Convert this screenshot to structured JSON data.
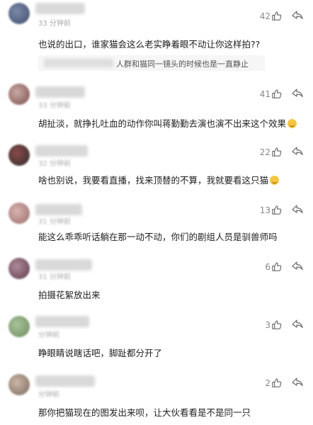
{
  "comments": [
    {
      "time": "33 分钟前",
      "likes": "42",
      "text": "也说的出口，谁家猫会这么老实睁着眼不动让你这样拍??",
      "reply": "人群和猫同一镜头的时候也是一直静止",
      "avatar_colors": [
        "#7b8aa8",
        "#3f4c6b"
      ]
    },
    {
      "time": "33 分钟前",
      "likes": "41",
      "text": "胡扯淡，就挣扎吐血的动作你叫蒋勤勤去演也演不出来这个效果",
      "emoji": "dizzy-face",
      "avatar_colors": [
        "#c9a9a6",
        "#7a4e4a"
      ]
    },
    {
      "time": "32 分钟前",
      "likes": "22",
      "text": "啥也别说，我要看直播，找来顶替的不算，我就要看这只猫",
      "emoji": "grin-face",
      "avatar_colors": [
        "#8a4a4a",
        "#2f2b2b"
      ]
    },
    {
      "time": "31 分钟前",
      "likes": "13",
      "text": "能这么乖乖听话躺在那一动不动，你们的剧组人员是驯兽师吗",
      "avatar_colors": [
        "#d8b3b0",
        "#9a6c69"
      ]
    },
    {
      "time": "31 分钟前",
      "likes": "6",
      "text": "拍摄花絮放出来",
      "avatar_colors": [
        "#5a3a4a",
        "#b08a9a"
      ]
    },
    {
      "time": "分钟前",
      "likes": "3",
      "text": "睁眼睛说瞎话吧，脚趾都分开了",
      "avatar_colors": [
        "#a8c49a",
        "#6c8a5e"
      ]
    },
    {
      "time": "分钟前",
      "likes": "2",
      "text": "那你把猫现在的图发出来呗，让大伙看看是不是同一只",
      "avatar_colors": [
        "#7e6a5e",
        "#c8b6a6"
      ]
    }
  ]
}
